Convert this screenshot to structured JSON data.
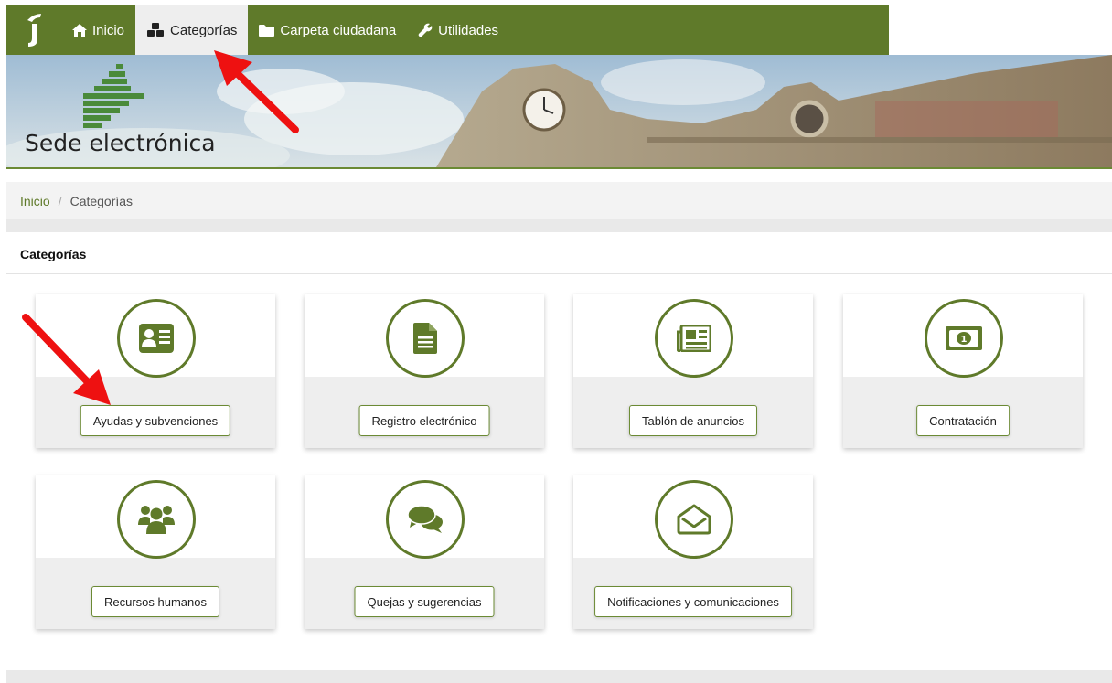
{
  "nav": {
    "items": [
      {
        "label": "Inicio",
        "icon": "home-icon"
      },
      {
        "label": "Categorías",
        "icon": "cubes-icon",
        "active": true
      },
      {
        "label": "Carpeta ciudadana",
        "icon": "folder-icon"
      },
      {
        "label": "Utilidades",
        "icon": "wrench-icon"
      }
    ]
  },
  "banner": {
    "title": "Sede electrónica"
  },
  "breadcrumb": {
    "home": "Inicio",
    "separator": "/",
    "current": "Categorías"
  },
  "section": {
    "title": "Categorías"
  },
  "categories": [
    {
      "label": "Ayudas y subvenciones",
      "icon": "id-card-icon"
    },
    {
      "label": "Registro electrónico",
      "icon": "document-icon"
    },
    {
      "label": "Tablón de anuncios",
      "icon": "newspaper-icon"
    },
    {
      "label": "Contratación",
      "icon": "money-bill-icon"
    },
    {
      "label": "Recursos humanos",
      "icon": "users-icon"
    },
    {
      "label": "Quejas y sugerencias",
      "icon": "comments-icon"
    },
    {
      "label": "Notificaciones y comunicaciones",
      "icon": "envelope-open-icon"
    }
  ],
  "colors": {
    "brand": "#5f7a2a",
    "annotation_arrow": "#ee1111"
  }
}
